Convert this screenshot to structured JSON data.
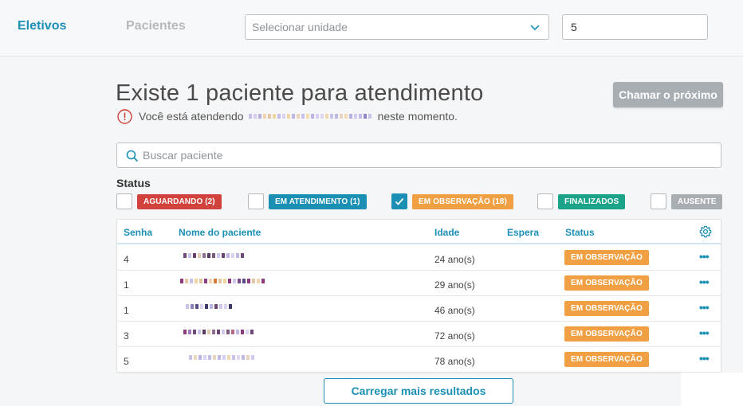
{
  "nav": {
    "tab_eletivos": "Eletivos",
    "tab_pacientes": "Pacientes"
  },
  "unit_select": {
    "placeholder": "Selecionar unidade"
  },
  "number_input": {
    "value": "5"
  },
  "headline": "Existe 1 paciente para atendimento",
  "call_next_label": "Chamar o próximo",
  "notice": {
    "prefix": "Você está atendendo",
    "suffix": "neste momento."
  },
  "search": {
    "placeholder": "Buscar paciente"
  },
  "status_label": "Status",
  "filters": [
    {
      "label": "AGUARDANDO (2)",
      "checked": false,
      "color": "#d0423b"
    },
    {
      "label": "EM ATENDIMENTO (1)",
      "checked": false,
      "color": "#1b8fb4"
    },
    {
      "label": "EM OBSERVAÇÃO (18)",
      "checked": true,
      "color": "#f0a042"
    },
    {
      "label": "FINALIZADOS",
      "checked": false,
      "color": "#1aa389"
    },
    {
      "label": "AUSENTE",
      "checked": false,
      "color": "#a9aeb3"
    }
  ],
  "table": {
    "headers": {
      "senha": "Senha",
      "nome": "Nome do paciente",
      "idade": "Idade",
      "espera": "Espera",
      "status": "Status"
    },
    "rows": [
      {
        "senha": "4",
        "idade": "24 ano(s)",
        "espera": "",
        "status": "EM OBSERVAÇÃO"
      },
      {
        "senha": "1",
        "idade": "29 ano(s)",
        "espera": "",
        "status": "EM OBSERVAÇÃO"
      },
      {
        "senha": "1",
        "idade": "46 ano(s)",
        "espera": "",
        "status": "EM OBSERVAÇÃO"
      },
      {
        "senha": "3",
        "idade": "72 ano(s)",
        "espera": "",
        "status": "EM OBSERVAÇÃO"
      },
      {
        "senha": "5",
        "idade": "78 ano(s)",
        "espera": "",
        "status": "EM OBSERVAÇÃO"
      }
    ],
    "row_actions_label": "•••"
  },
  "load_more_label": "Carregar mais resultados",
  "icons": {
    "select_chevron": "chevron-down-icon",
    "notice": "info-circle-icon",
    "search": "search-icon",
    "settings": "gear-icon",
    "check": "check-icon"
  },
  "colors": {
    "accent": "#1b8fb4",
    "observacao": "#f0a042"
  }
}
